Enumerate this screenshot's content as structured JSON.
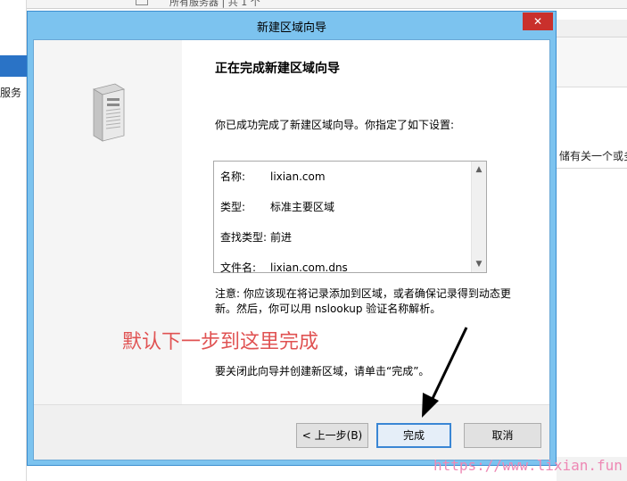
{
  "background": {
    "left_panel_text": "服务",
    "top_text": "所有服务器 | 共 1 个",
    "right_panel_text": "储有关一个或多"
  },
  "wizard": {
    "title": "新建区域向导",
    "close_label": "✕",
    "heading": "正在完成新建区域向导",
    "intro": "你已成功完成了新建区域向导。你指定了如下设置:",
    "summary": [
      {
        "key": "名称:",
        "value": "lixian.com"
      },
      {
        "key": "类型:",
        "value": "标准主要区域"
      },
      {
        "key": "查找类型:",
        "value": "前进"
      },
      {
        "key": "文件名:",
        "value": "lixian.com.dns"
      }
    ],
    "note": "注意: 你应该现在将记录添加到区域，或者确保记录得到动态更新。然后，你可以用 nslookup 验证名称解析。",
    "finish_hint": "要关闭此向导并创建新区域，请单击“完成”。",
    "buttons": {
      "back": "< 上一步(B)",
      "finish": "完成",
      "cancel": "取消"
    }
  },
  "annotation": {
    "text": "默认下一步到这里完成",
    "color": "#e05252"
  },
  "watermark": "https://www.lixian.fun",
  "colors": {
    "titlebar": "#7cc3ef",
    "close_button": "#c9302c",
    "default_button_border": "#3a86d4"
  }
}
